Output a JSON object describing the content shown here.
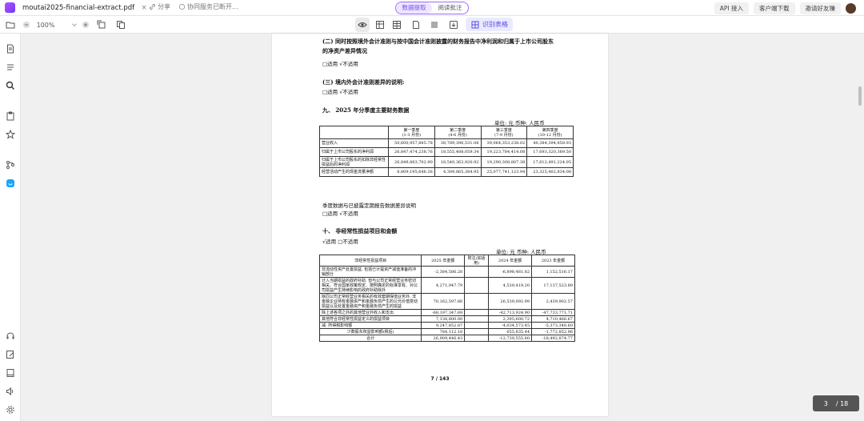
{
  "tab": {
    "filename": "moutai2025-financial-extract.pdf",
    "close": "×"
  },
  "title_actions": {
    "share": "分享",
    "sync_status": "协同服务已断开..."
  },
  "mode": {
    "extract": "数据提取",
    "annotate": "阅读批注"
  },
  "top_right": {
    "api": "API 接入",
    "download": "客户端下载",
    "invite": "邀请好友赚"
  },
  "toolbar": {
    "zoom": "100%",
    "ocr_label": "识别表格"
  },
  "doc": {
    "sec2_title_line1": "(二) 同时按照境外会计准则与按中国会计准则披露的财务报告中净利润和归属于上市公司股东",
    "sec2_title_line2": "的净资产差异情况",
    "sec2_check": "□适用 √不适用",
    "sec3_title": "(三) 境内外会计准则差异的说明:",
    "sec3_check": "□适用 √不适用",
    "sec9_title": "九、 2025 年分季度主要财务数据",
    "unit1": "单位: 元 币种: 人民币",
    "t1_headers": [
      {
        "l1": "",
        "l2": ""
      },
      {
        "l1": "第一季度",
        "l2": "(1-3 月份)"
      },
      {
        "l1": "第二季度",
        "l2": "(4-6 月份)"
      },
      {
        "l1": "第三季度",
        "l2": "(7-9 月份)"
      },
      {
        "l1": "第四季度",
        "l2": "(10-12 月份)"
      }
    ],
    "t1_rows": [
      [
        "营业收入",
        "50,600,957,885.78",
        "38,789,396,531.06",
        "39,064,353,238.02",
        "40,384,394,858.93"
      ],
      [
        "归属于上市公司股东的净利润",
        "26,847,474,238.76",
        "18,555,488,059.34",
        "19,223,784,414.08",
        "17,693,320,389.50"
      ],
      [
        "归属于上市公司股东的扣除非经常性损益后的净利润",
        "26,849,883,702.90",
        "18,540,363,920.92",
        "19,290,308,807.38",
        "17,612,491,224.05"
      ],
      [
        "经营活动产生的现金流量净额",
        "8,809,195,646.38",
        "4,309,865,384.95",
        "25,077,741,123.94",
        "23,325,402,834.08"
      ]
    ],
    "quarter_note": "季度数据与已披露定期报告数据差异说明",
    "quarter_check": "□适用 √不适用",
    "sec10_title": "十、 非经常性损益项目和金额",
    "sec10_check": "√适用 □不适用",
    "unit2": "单位: 元 币种: 人民币",
    "t2_headers": [
      "非经常性损益项目",
      "2025 年金额",
      "附注(如适用)",
      "2024 年金额",
      "2023 年金额"
    ],
    "t2_rows": [
      [
        "非流动性资产处置损益, 包括已计提资产减值准备的冲销部分",
        "-2,384,586.28",
        "",
        "-6,898,481.82",
        "1,152,516.17"
      ],
      [
        "计入当期损益的政府补助, 但与公司正常经营业务密切相关、符合国家政策规定、按照确定的标准享有、对公司损益产生持续影响的政府补助除外",
        "4,271,947.79",
        "",
        "4,539,419.20",
        "17,137,523.89"
      ],
      [
        "除同公司正常经营业务相关的有效套期保值业务外, 非金融企业持有金融资产和金融负债产生的公允价值变动损益以及处置金融资产和金融负债产生的损益",
        "70,162,597.66",
        "",
        "26,539,092.99",
        "2,439,902.57"
      ],
      [
        "除上述各项之外的其他营业外收入和支出",
        "-68,197,347.69",
        "",
        "-42,713,924.90",
        "-47,733,771.71"
      ],
      [
        "其他符合非经常性损益定义的损益项目",
        "7,138,800.00",
        "",
        "2,395,600.72",
        "4,710,466.67"
      ],
      [
        "减: 所得税影响额",
        "9,247,852.87",
        "",
        "-4,034,573.45",
        "-5,373,340.60"
      ],
      [
        "少数股东权益影响额(税后)",
        "784,112.18",
        "",
        "655,835.44",
        "-1,772,852.96"
      ],
      [
        "合计",
        "26,909,446.43",
        "",
        "-12,739,555.80",
        "-18,492,874.77"
      ]
    ],
    "page_footer": "7 / 143"
  },
  "pager": {
    "current": "3",
    "total": "/ 18"
  }
}
